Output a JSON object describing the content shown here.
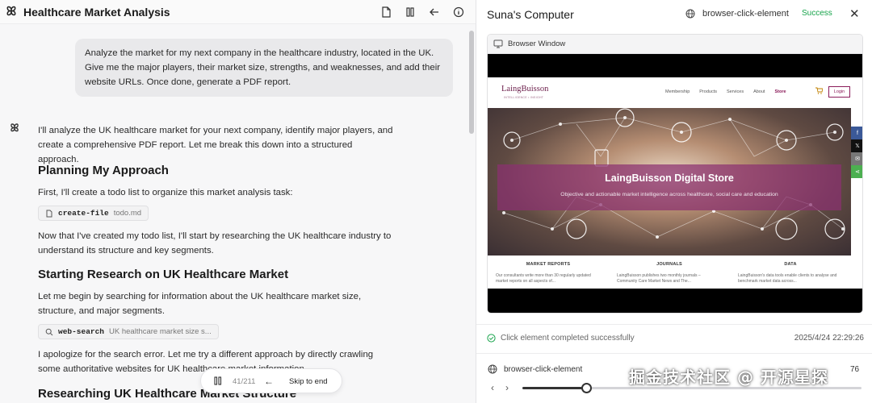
{
  "left": {
    "title": "Healthcare Market Analysis",
    "user_message": "Analyze the market for my next company in the healthcare industry, located in the UK. Give me the major players, their market size, strengths, and weaknesses, and add their website URLs. Once done, generate a PDF report.",
    "intro": "I'll analyze the UK healthcare market for your next company, identify major players, and create a comprehensive PDF report. Let me break this down into a structured approach.",
    "h_planning": "Planning My Approach",
    "p_todo": "First, I'll create a todo list to organize this market analysis task:",
    "tool1": {
      "name": "create-file",
      "arg": "todo.md"
    },
    "p_after_todo": "Now that I've created my todo list, I'll start by researching the UK healthcare industry to understand its structure and key segments.",
    "h_research": "Starting Research on UK Healthcare Market",
    "p_search": "Let me begin by searching for information about the UK healthcare market size, structure, and major segments.",
    "tool2": {
      "name": "web-search",
      "arg": "UK healthcare market size s..."
    },
    "p_error": "I apologize for the search error. Let me try a different approach by directly crawling some authoritative websites for UK healthcare market information.",
    "h_structure": "Researching UK Healthcare Market Structure",
    "player": {
      "count": "41/211",
      "skip": "Skip to end"
    }
  },
  "right": {
    "title": "Suna's Computer",
    "tool": "browser-click-element",
    "status": "Success",
    "status_color": "#16a34a",
    "browser_label": "Browser Window",
    "site": {
      "logo": "LaingBuisson",
      "logo_sub": "INTELLIGENCE • INSIGHT",
      "menu": [
        "Membership",
        "Products",
        "Services",
        "About",
        "Store"
      ],
      "login": "Login",
      "hero_title": "LaingBuisson Digital Store",
      "hero_sub": "Objective and actionable market intelligence across healthcare, social care and education",
      "cols": [
        {
          "h": "MARKET REPORTS",
          "t": "Our consultants write more than 30 regularly updated market reports on all aspects of..."
        },
        {
          "h": "JOURNALS",
          "t": "LaingBuisson publishes two monthly journals – Community Care Market News and The..."
        },
        {
          "h": "DATA",
          "t": "LaingBuisson's data tools enable clients to analyse and benchmark market data across..."
        }
      ]
    },
    "result_msg": "Click element completed successfully",
    "timestamp": "2025/4/24 22:29:26",
    "footer_tool": "browser-click-element",
    "footer_count": "76",
    "progress": 0.19
  },
  "watermark": "掘金技术社区 @ 开源星探"
}
